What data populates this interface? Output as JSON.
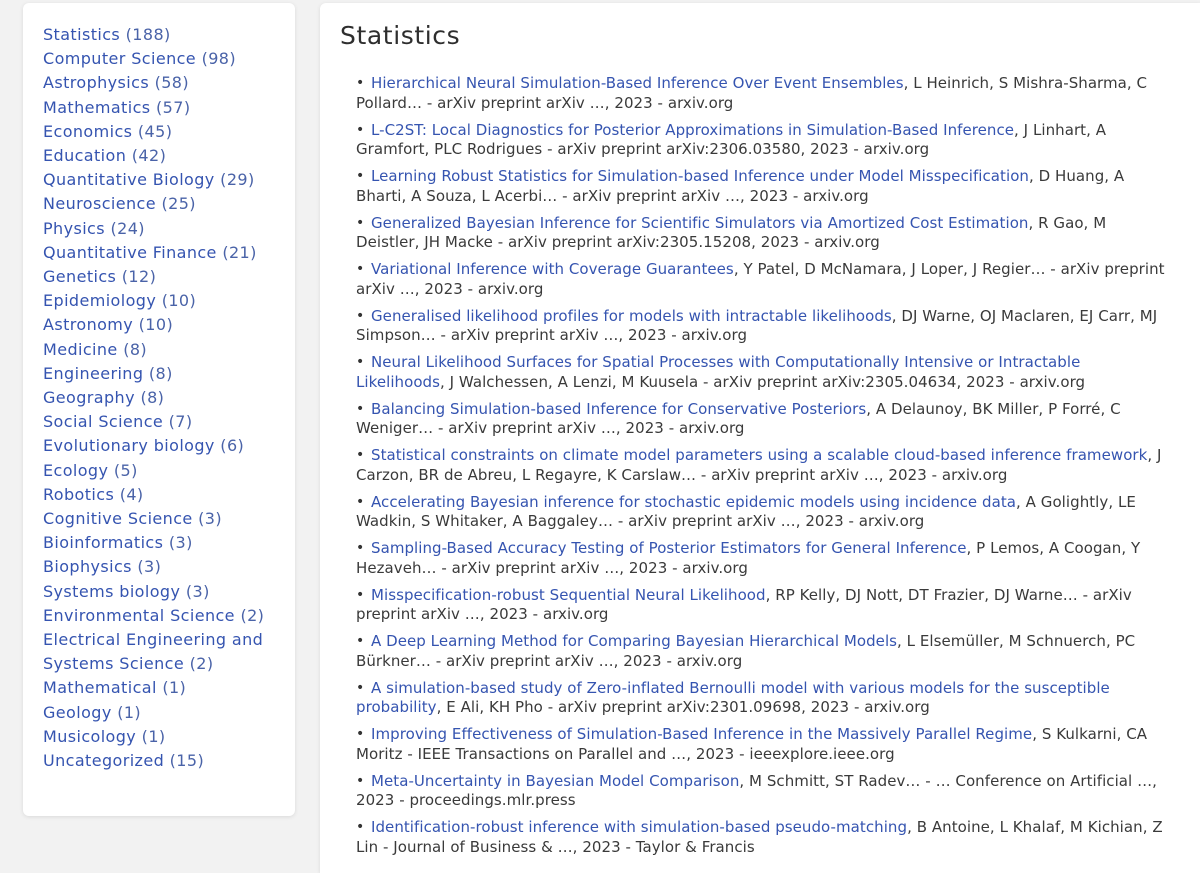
{
  "sidebar": {
    "categories": [
      {
        "label": "Statistics",
        "count": "(188)"
      },
      {
        "label": "Computer Science",
        "count": "(98)"
      },
      {
        "label": "Astrophysics",
        "count": "(58)"
      },
      {
        "label": "Mathematics",
        "count": "(57)"
      },
      {
        "label": "Economics",
        "count": "(45)"
      },
      {
        "label": "Education",
        "count": "(42)"
      },
      {
        "label": "Quantitative Biology",
        "count": "(29)"
      },
      {
        "label": "Neuroscience",
        "count": "(25)"
      },
      {
        "label": "Physics",
        "count": "(24)"
      },
      {
        "label": "Quantitative Finance",
        "count": "(21)"
      },
      {
        "label": "Genetics",
        "count": "(12)"
      },
      {
        "label": "Epidemiology",
        "count": "(10)"
      },
      {
        "label": "Astronomy",
        "count": "(10)"
      },
      {
        "label": "Medicine",
        "count": "(8)"
      },
      {
        "label": "Engineering",
        "count": "(8)"
      },
      {
        "label": "Geography",
        "count": "(8)"
      },
      {
        "label": "Social Science",
        "count": "(7)"
      },
      {
        "label": "Evolutionary biology",
        "count": "(6)"
      },
      {
        "label": "Ecology",
        "count": "(5)"
      },
      {
        "label": "Robotics",
        "count": "(4)"
      },
      {
        "label": "Cognitive Science",
        "count": "(3)"
      },
      {
        "label": "Bioinformatics",
        "count": "(3)"
      },
      {
        "label": "Biophysics",
        "count": "(3)"
      },
      {
        "label": "Systems biology",
        "count": "(3)"
      },
      {
        "label": "Environmental Science",
        "count": "(2)"
      },
      {
        "label": "Electrical Engineering and Systems Science",
        "count": "(2)"
      },
      {
        "label": "Mathematical",
        "count": "(1)"
      },
      {
        "label": "Geology",
        "count": "(1)"
      },
      {
        "label": "Musicology",
        "count": "(1)"
      },
      {
        "label": "Uncategorized",
        "count": "(15)"
      }
    ]
  },
  "main": {
    "title": "Statistics",
    "publications": [
      {
        "title": "Hierarchical Neural Simulation-Based Inference Over Event Ensembles",
        "details": ", L Heinrich, S Mishra-Sharma, C Pollard… - arXiv preprint arXiv …, 2023 - arxiv.org"
      },
      {
        "title": "L-C2ST: Local Diagnostics for Posterior Approximations in Simulation-Based Inference",
        "details": ", J Linhart, A Gramfort, PLC Rodrigues - arXiv preprint arXiv:2306.03580, 2023 - arxiv.org"
      },
      {
        "title": "Learning Robust Statistics for Simulation-based Inference under Model Misspecification",
        "details": ", D Huang, A Bharti, A Souza, L Acerbi… - arXiv preprint arXiv …, 2023 - arxiv.org"
      },
      {
        "title": "Generalized Bayesian Inference for Scientific Simulators via Amortized Cost Estimation",
        "details": ", R Gao, M Deistler, JH Macke - arXiv preprint arXiv:2305.15208, 2023 - arxiv.org"
      },
      {
        "title": "Variational Inference with Coverage Guarantees",
        "details": ", Y Patel, D McNamara, J Loper, J Regier… - arXiv preprint arXiv …, 2023 - arxiv.org"
      },
      {
        "title": "Generalised likelihood profiles for models with intractable likelihoods",
        "details": ", DJ Warne, OJ Maclaren, EJ Carr, MJ Simpson… - arXiv preprint arXiv …, 2023 - arxiv.org"
      },
      {
        "title": "Neural Likelihood Surfaces for Spatial Processes with Computationally Intensive or Intractable Likelihoods",
        "details": ", J Walchessen, A Lenzi, M Kuusela - arXiv preprint arXiv:2305.04634, 2023 - arxiv.org"
      },
      {
        "title": "Balancing Simulation-based Inference for Conservative Posteriors",
        "details": ", A Delaunoy, BK Miller, P Forré, C Weniger… - arXiv preprint arXiv …, 2023 - arxiv.org"
      },
      {
        "title": "Statistical constraints on climate model parameters using a scalable cloud-based inference framework",
        "details": ", J Carzon, BR de Abreu, L Regayre, K Carslaw… - arXiv preprint arXiv …, 2023 - arxiv.org"
      },
      {
        "title": "Accelerating Bayesian inference for stochastic epidemic models using incidence data",
        "details": ", A Golightly, LE Wadkin, S Whitaker, A Baggaley… - arXiv preprint arXiv …, 2023 - arxiv.org"
      },
      {
        "title": "Sampling-Based Accuracy Testing of Posterior Estimators for General Inference",
        "details": ", P Lemos, A Coogan, Y Hezaveh… - arXiv preprint arXiv …, 2023 - arxiv.org"
      },
      {
        "title": "Misspecification-robust Sequential Neural Likelihood",
        "details": ", RP Kelly, DJ Nott, DT Frazier, DJ Warne… - arXiv preprint arXiv …, 2023 - arxiv.org"
      },
      {
        "title": "A Deep Learning Method for Comparing Bayesian Hierarchical Models",
        "details": ", L Elsemüller, M Schnuerch, PC Bürkner… - arXiv preprint arXiv …, 2023 - arxiv.org"
      },
      {
        "title": "A simulation-based study of Zero-inflated Bernoulli model with various models for the susceptible probability",
        "details": ", E Ali, KH Pho - arXiv preprint arXiv:2301.09698, 2023 - arxiv.org"
      },
      {
        "title": "Improving Effectiveness of Simulation-Based Inference in the Massively Parallel Regime",
        "details": ", S Kulkarni, CA Moritz - IEEE Transactions on Parallel and …, 2023 - ieeexplore.ieee.org"
      },
      {
        "title": "Meta-Uncertainty in Bayesian Model Comparison",
        "details": ", M Schmitt, ST Radev… - … Conference on Artificial …, 2023 - proceedings.mlr.press"
      },
      {
        "title": "Identification-robust inference with simulation-based pseudo-matching",
        "details": ", B Antoine, L Khalaf, M Kichian, Z Lin - Journal of Business & …, 2023 - Taylor & Francis"
      }
    ]
  }
}
